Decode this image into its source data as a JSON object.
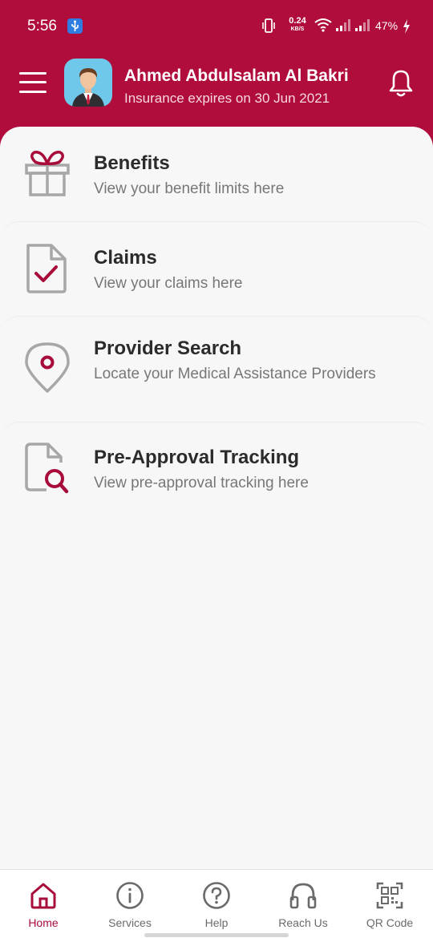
{
  "status_bar": {
    "time": "5:56",
    "net_speed": "0.24",
    "net_unit": "KB/S",
    "battery": "47%"
  },
  "header": {
    "user_name": "Ahmed Abdulsalam Al Bakri",
    "expiry_text": "Insurance expires on 30 Jun 2021"
  },
  "menu": [
    {
      "title": "Benefits",
      "subtitle": "View your benefit limits here",
      "icon": "gift-icon"
    },
    {
      "title": "Claims",
      "subtitle": "View your claims here",
      "icon": "document-check-icon"
    },
    {
      "title": "Provider Search",
      "subtitle": "Locate your Medical Assistance Providers",
      "icon": "location-pin-icon"
    },
    {
      "title": "Pre-Approval Tracking",
      "subtitle": "View pre-approval tracking here",
      "icon": "document-search-icon"
    }
  ],
  "bottom_nav": [
    {
      "label": "Home",
      "icon": "home-icon",
      "active": true
    },
    {
      "label": "Services",
      "icon": "info-icon",
      "active": false
    },
    {
      "label": "Help",
      "icon": "help-icon",
      "active": false
    },
    {
      "label": "Reach Us",
      "icon": "headphones-icon",
      "active": false
    },
    {
      "label": "QR Code",
      "icon": "qr-code-icon",
      "active": false
    }
  ],
  "colors": {
    "brand": "#b00c3c",
    "accent": "#a80c3a",
    "icon_gray": "#a7a7a7"
  }
}
